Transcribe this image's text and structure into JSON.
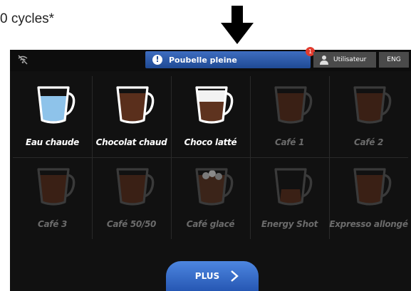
{
  "caption": "0 cycles*",
  "topbar": {
    "notification": {
      "text": "Poubelle pleine",
      "badge": "1"
    },
    "user_label": "Utilisateur",
    "language": "ENG"
  },
  "drinks": [
    {
      "label": "Eau chaude",
      "available": true,
      "fill": "water",
      "icon": "cup-icon"
    },
    {
      "label": "Chocolat chaud",
      "available": true,
      "fill": "chocolate",
      "icon": "cup-icon"
    },
    {
      "label": "Choco latté",
      "available": true,
      "fill": "latte",
      "icon": "cup-icon"
    },
    {
      "label": "Café 1",
      "available": false,
      "fill": "coffee",
      "icon": "cup-icon"
    },
    {
      "label": "Café 2",
      "available": false,
      "fill": "coffee",
      "icon": "cup-icon"
    },
    {
      "label": "Café 3",
      "available": false,
      "fill": "coffee",
      "icon": "cup-icon"
    },
    {
      "label": "Café 50/50",
      "available": false,
      "fill": "coffee",
      "icon": "cup-icon"
    },
    {
      "label": "Café glacé",
      "available": false,
      "fill": "iced",
      "icon": "cup-icon"
    },
    {
      "label": "Energy Shot",
      "available": false,
      "fill": "shot",
      "icon": "cup-icon"
    },
    {
      "label": "Expresso allongé",
      "available": false,
      "fill": "coffee",
      "icon": "cup-icon"
    }
  ],
  "more_button": {
    "label": "PLUS"
  },
  "colors": {
    "accent": "#2f64c4",
    "background": "#111111",
    "badge": "#e23b2e"
  }
}
